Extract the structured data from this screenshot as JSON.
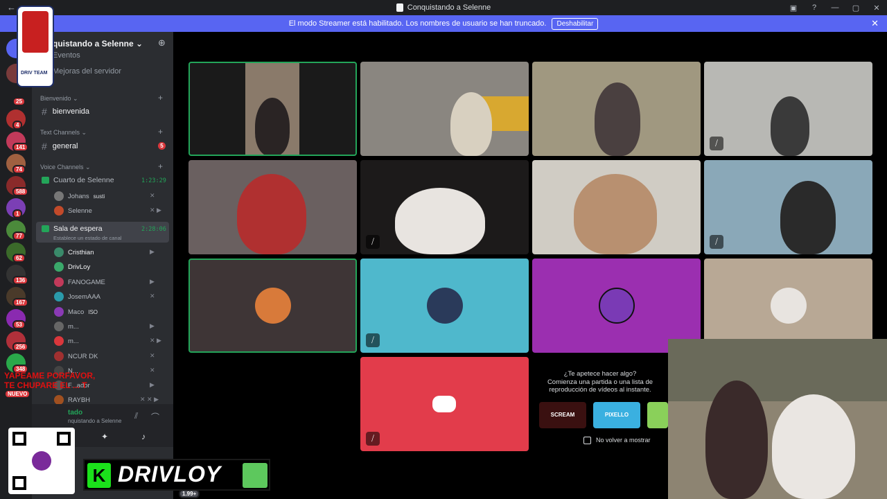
{
  "window": {
    "title": "Conquistando a Selenne"
  },
  "banner": {
    "text": "El modo Streamer está habilitado. Los nombres de usuario se han truncado.",
    "button": "Deshabilitar"
  },
  "servers": {
    "badges": [
      "25",
      "4",
      "141",
      "74",
      "588",
      "1",
      "77",
      "62",
      "136",
      "167",
      "53",
      "256",
      "348"
    ],
    "new_label": "NUEVO",
    "bottom_badge": "1.99+"
  },
  "sidebar": {
    "server_name": "quistando a Selenne",
    "events": "Eventos",
    "boosts": "Mejoras del servidor",
    "cat_welcome": "Bienvenido",
    "chan_welcome": "bienvenida",
    "cat_text": "Text Channels",
    "chan_general": "general",
    "general_badge": "5",
    "cat_voice": "Voice Channels",
    "voice1": {
      "name": "Cuarto de Selenne",
      "timer": "1:23:29"
    },
    "voice1_users": [
      {
        "name": "Johans",
        "tag": "susti"
      },
      {
        "name": "Selenne",
        "tag": ""
      }
    ],
    "voice2": {
      "name": "Sala de espera",
      "timer": "2:28:06",
      "status": "Establece un estado de canal"
    },
    "voice2_users": [
      {
        "name": "Cristhian",
        "tag": ""
      },
      {
        "name": "DrivLoy",
        "tag": ""
      },
      {
        "name": "FANOGAME",
        "tag": ""
      },
      {
        "name": "JosemAAA",
        "tag": ""
      },
      {
        "name": "Maco",
        "tag": "ISO"
      },
      {
        "name": "m...",
        "tag": ""
      },
      {
        "name": "m...",
        "tag": ""
      },
      {
        "name": "NCUR DK",
        "tag": ""
      },
      {
        "name": "N...",
        "tag": ""
      },
      {
        "name": "F...ador",
        "tag": ""
      },
      {
        "name": "RAYBH",
        "tag": ""
      }
    ],
    "userbar": {
      "status": "tado",
      "server": "nquistando a Selenne"
    }
  },
  "activity": {
    "title": "¿Te apetece hacer algo?",
    "subtitle": "Comienza una partida o una lista de reproducción de vídeos al instante.",
    "games": [
      "SCREAM",
      "PIXELLO"
    ],
    "checkbox": "No volver a mostrar"
  },
  "overlay": {
    "line1": "YAPEAME PORFAVOR,",
    "line2": "TE CHUPARE EL ... T",
    "brand": "DRIVLOY",
    "k": "K",
    "logo_text": "DRIV TEAM"
  },
  "colors": {
    "accent": "#5865f2",
    "online": "#23a559",
    "danger": "#da373c",
    "teal_tile": "#4fb8cc",
    "purple_tile": "#9b2fb0",
    "red_tile": "#e23c4b",
    "brown_tile": "#3e3536",
    "beige_tile": "#b8a895"
  }
}
